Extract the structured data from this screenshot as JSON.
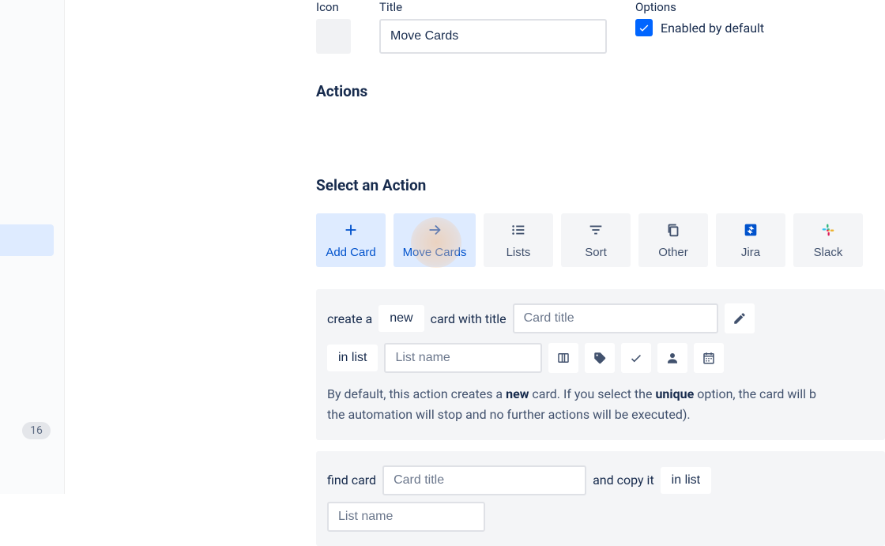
{
  "sidebar": {
    "badge": "16"
  },
  "header": {
    "icon_label": "Icon",
    "title_label": "Title",
    "title_value": "Move Cards",
    "options_label": "Options",
    "enabled_label": "Enabled by default"
  },
  "sections": {
    "actions": "Actions",
    "select": "Select an Action"
  },
  "tiles": {
    "add_card": "Add Card",
    "move_cards": "Move Cards",
    "lists": "Lists",
    "sort": "Sort",
    "other": "Other",
    "jira": "Jira",
    "slack": "Slack"
  },
  "panel_create": {
    "create_a": "create a",
    "new_token": "new",
    "card_with_title": "card with title",
    "card_title_ph": "Card title",
    "in_list_token": "in list",
    "list_name_ph": "List name",
    "desc_prefix": "By default, this action creates a ",
    "desc_new": "new",
    "desc_mid": " card. If you select the ",
    "desc_unique": "unique",
    "desc_suffix": " option, the card will b",
    "desc_line2": "the automation will stop and no further actions will be executed)."
  },
  "panel_find": {
    "find_card": "find card",
    "card_title_ph": "Card title",
    "and_copy": "and copy it",
    "in_list": "in list",
    "list_name_ph": "List name"
  }
}
